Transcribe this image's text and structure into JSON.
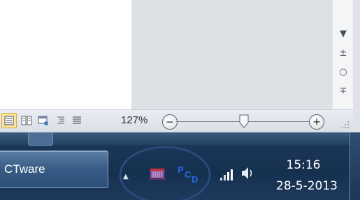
{
  "status_bar": {
    "zoom_level": "127%",
    "zoom_out_glyph": "−",
    "zoom_in_glyph": "+",
    "view_buttons": [
      "print-layout-icon",
      "full-screen-reading-icon",
      "web-layout-icon",
      "outline-icon",
      "draft-icon"
    ]
  },
  "vertical_scrollbar": {
    "scroll_down_glyph": "▼",
    "prev_page_glyph": "±",
    "select_browse_glyph": "○",
    "next_page_glyph": "∓"
  },
  "taskbar": {
    "task_button_label": "CTware",
    "tray_expand_glyph": "▲",
    "pcd_letters": [
      "P",
      "C",
      "D"
    ],
    "clock_time": "15:16",
    "clock_date": "28-5-2013"
  },
  "colors": {
    "taskbar": "#1b3657",
    "highlight_ellipse": "#2a4a78",
    "pcd_icon": "#2a66e0"
  }
}
